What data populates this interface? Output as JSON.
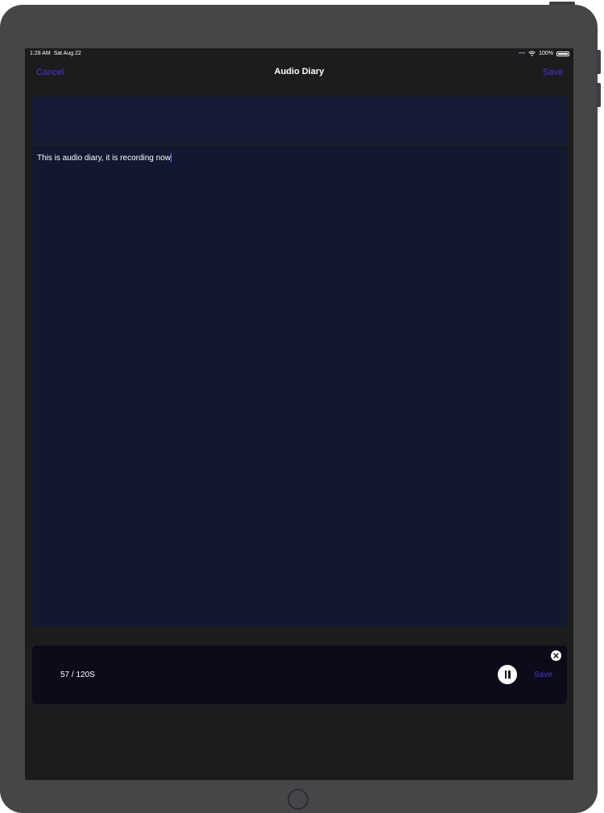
{
  "status_bar": {
    "time": "1:28 AM",
    "date": "Sat Aug 22",
    "battery": "100%"
  },
  "nav": {
    "cancel_label": "Cancel",
    "title": "Audio Diary",
    "save_label": "Save"
  },
  "editor": {
    "text": "This is audio diary, it is recording now"
  },
  "recorder": {
    "progress": "57 / 120S",
    "save_label": "Save"
  },
  "colors": {
    "accent": "#4535d8",
    "screen_bg": "#1c1c1e",
    "editor_bg": "#121830",
    "recorder_bg": "#0c0b1a",
    "device_frame": "#464548"
  },
  "icons": {
    "pause": "pause-icon",
    "close": "close-icon",
    "wifi": "wifi-icon",
    "battery": "battery-icon"
  }
}
